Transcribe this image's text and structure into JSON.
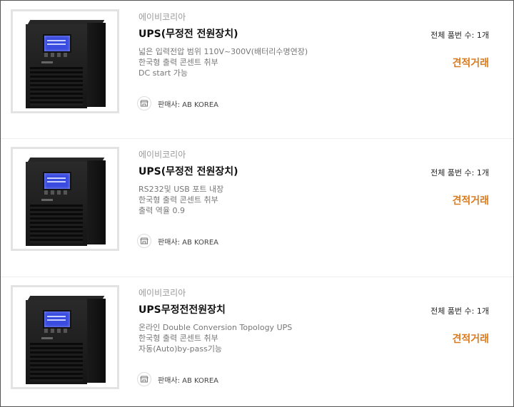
{
  "products": [
    {
      "brand": "에이비코리아",
      "title": "UPS(무정전 전원장치)",
      "features": [
        "넓은 입력전압 범위 110V~300V(배터리수명연장)",
        "한국형 출력 콘센트 취부",
        "DC start 가능"
      ],
      "seller": "판매사: AB KOREA",
      "count": "전체 품번 수: 1개",
      "action": "견적거래"
    },
    {
      "brand": "에이비코리아",
      "title": "UPS(무정전 전원장치)",
      "features": [
        "RS232및 USB 포트 내장",
        "한국형 출력 콘센트 취부",
        "출력 역율 0.9"
      ],
      "seller": "판매사: AB KOREA",
      "count": "전체 품번 수: 1개",
      "action": "견적거래"
    },
    {
      "brand": "에이비코리아",
      "title": "UPS무정전전원장치",
      "features": [
        "온라인 Double Conversion Topology UPS",
        "한국형 출력 콘센트 취부",
        "자동(Auto)by-pass기능"
      ],
      "seller": "판매사: AB KOREA",
      "count": "전체 품번 수: 1개",
      "action": "견적거래"
    }
  ],
  "colors": {
    "accent": "#d97b1f",
    "brand_text": "#9a9a9a",
    "feature_text": "#777777"
  },
  "icons": {
    "product_image": "ups-device",
    "seller": "storefront-icon"
  }
}
